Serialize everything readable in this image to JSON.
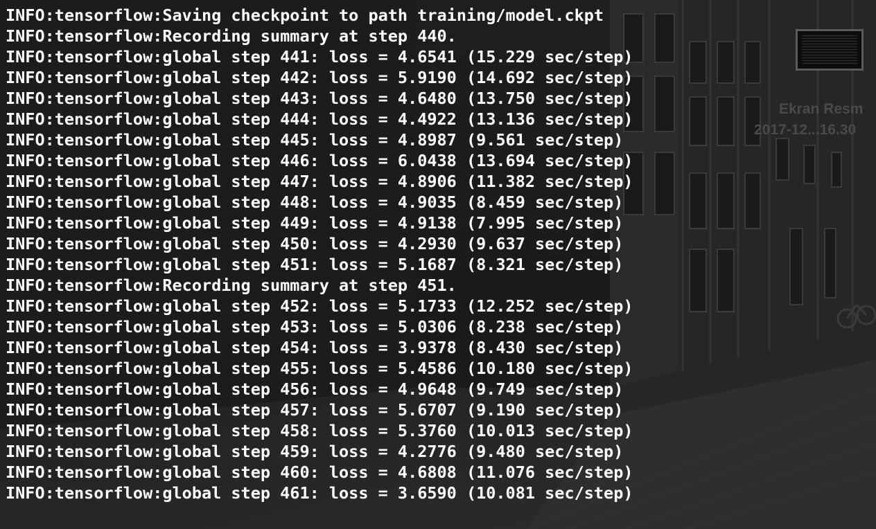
{
  "colors": {
    "text": "#ffffff",
    "background": "#161616"
  },
  "desktop": {
    "thumbnail_icon": "screenshot-file-icon",
    "file_name": "Ekran Resm",
    "file_date": "2017-12...16.30"
  },
  "terminal": {
    "lines": [
      "INFO:tensorflow:Saving checkpoint to path training/model.ckpt",
      "INFO:tensorflow:Recording summary at step 440.",
      "INFO:tensorflow:global step 441: loss = 4.6541 (15.229 sec/step)",
      "INFO:tensorflow:global step 442: loss = 5.9190 (14.692 sec/step)",
      "INFO:tensorflow:global step 443: loss = 4.6480 (13.750 sec/step)",
      "INFO:tensorflow:global step 444: loss = 4.4922 (13.136 sec/step)",
      "INFO:tensorflow:global step 445: loss = 4.8987 (9.561 sec/step)",
      "INFO:tensorflow:global step 446: loss = 6.0438 (13.694 sec/step)",
      "INFO:tensorflow:global step 447: loss = 4.8906 (11.382 sec/step)",
      "INFO:tensorflow:global step 448: loss = 4.9035 (8.459 sec/step)",
      "INFO:tensorflow:global step 449: loss = 4.9138 (7.995 sec/step)",
      "INFO:tensorflow:global step 450: loss = 4.2930 (9.637 sec/step)",
      "INFO:tensorflow:global step 451: loss = 5.1687 (8.321 sec/step)",
      "INFO:tensorflow:Recording summary at step 451.",
      "INFO:tensorflow:global step 452: loss = 5.1733 (12.252 sec/step)",
      "INFO:tensorflow:global step 453: loss = 5.0306 (8.238 sec/step)",
      "INFO:tensorflow:global step 454: loss = 3.9378 (8.430 sec/step)",
      "INFO:tensorflow:global step 455: loss = 5.4586 (10.180 sec/step)",
      "INFO:tensorflow:global step 456: loss = 4.9648 (9.749 sec/step)",
      "INFO:tensorflow:global step 457: loss = 5.6707 (9.190 sec/step)",
      "INFO:tensorflow:global step 458: loss = 5.3760 (10.013 sec/step)",
      "INFO:tensorflow:global step 459: loss = 4.2776 (9.480 sec/step)",
      "INFO:tensorflow:global step 460: loss = 4.6808 (11.076 sec/step)",
      "INFO:tensorflow:global step 461: loss = 3.6590 (10.081 sec/step)"
    ]
  }
}
